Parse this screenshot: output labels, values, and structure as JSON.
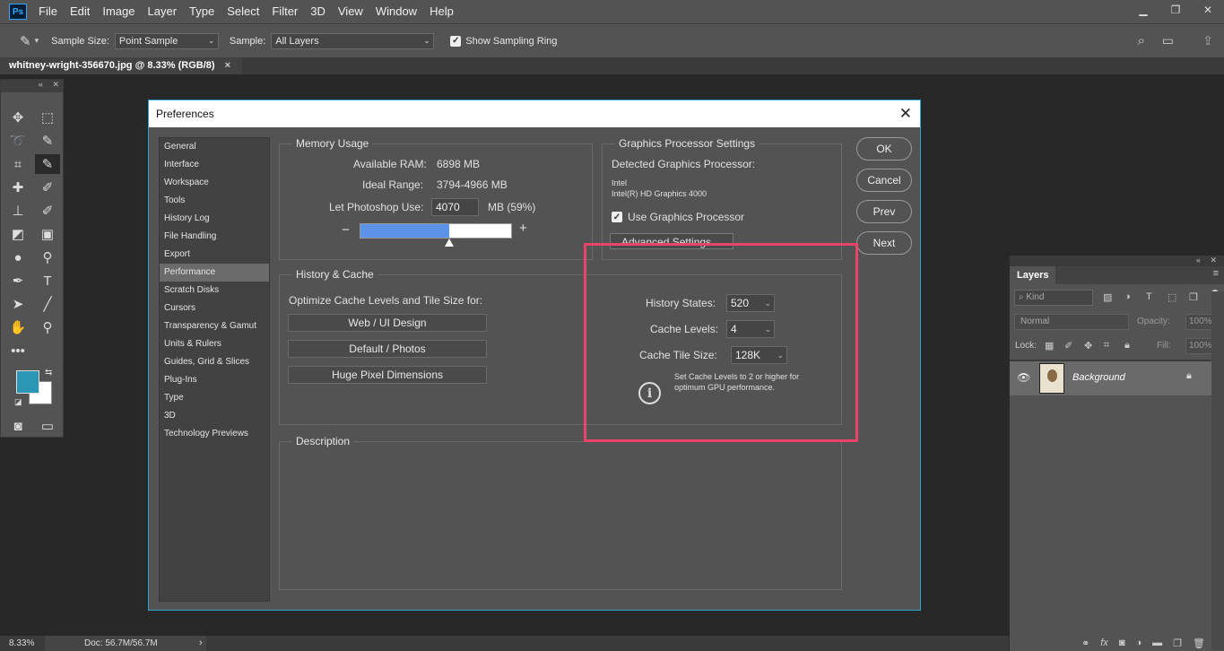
{
  "app": {
    "logo": "Ps",
    "menu": [
      "File",
      "Edit",
      "Image",
      "Layer",
      "Type",
      "Select",
      "Filter",
      "3D",
      "View",
      "Window",
      "Help"
    ]
  },
  "options": {
    "sample_size_label": "Sample Size:",
    "sample_size_value": "Point Sample",
    "sample_label": "Sample:",
    "sample_value": "All Layers",
    "show_ring_label": "Show Sampling Ring"
  },
  "document": {
    "tab_title": "whitney-wright-356670.jpg @ 8.33% (RGB/8)",
    "close": "×"
  },
  "status": {
    "zoom": "8.33%",
    "doc": "Doc: 56.7M/56.7M"
  },
  "dialog": {
    "title": "Preferences",
    "sidebar": [
      "General",
      "Interface",
      "Workspace",
      "Tools",
      "History Log",
      "File Handling",
      "Export",
      "Performance",
      "Scratch Disks",
      "Cursors",
      "Transparency & Gamut",
      "Units & Rulers",
      "Guides, Grid & Slices",
      "Plug-Ins",
      "Type",
      "3D",
      "Technology Previews"
    ],
    "buttons": {
      "ok": "OK",
      "cancel": "Cancel",
      "prev": "Prev",
      "next": "Next"
    },
    "memory": {
      "title": "Memory Usage",
      "available_label": "Available RAM:",
      "available_value": "6898 MB",
      "ideal_label": "Ideal Range:",
      "ideal_value": "3794-4966 MB",
      "let_label": "Let Photoshop Use:",
      "let_value": "4070",
      "let_suffix": "MB (59%)",
      "minus": "−",
      "plus": "+",
      "slider_fraction": 0.59
    },
    "gpu": {
      "title": "Graphics Processor Settings",
      "detected_label": "Detected Graphics Processor:",
      "vendor": "Intel",
      "model": "Intel(R) HD Graphics 4000",
      "use_label": "Use Graphics Processor",
      "advanced_label": "Advanced Settings..."
    },
    "history": {
      "title": "History & Cache",
      "optimize_label": "Optimize Cache Levels and Tile Size for:",
      "btn_web": "Web / UI Design",
      "btn_default": "Default / Photos",
      "btn_huge": "Huge Pixel Dimensions",
      "states_label": "History States:",
      "states_value": "520",
      "levels_label": "Cache Levels:",
      "levels_value": "4",
      "tile_label": "Cache Tile Size:",
      "tile_value": "128K",
      "note": "Set Cache Levels to 2 or higher for optimum GPU performance."
    },
    "description": {
      "title": "Description"
    }
  },
  "layers": {
    "tab": "Layers",
    "kind": "Kind",
    "blend": "Normal",
    "opacity_label": "Opacity:",
    "opacity_value": "100%",
    "lock_label": "Lock:",
    "fill_label": "Fill:",
    "fill_value": "100%",
    "layer_name": "Background"
  },
  "colors": {
    "highlight": "#e8436a",
    "accent_border": "#2aa4c9",
    "gpu_bar": "#5b93e8",
    "foreground_color": "#2b97b5"
  }
}
